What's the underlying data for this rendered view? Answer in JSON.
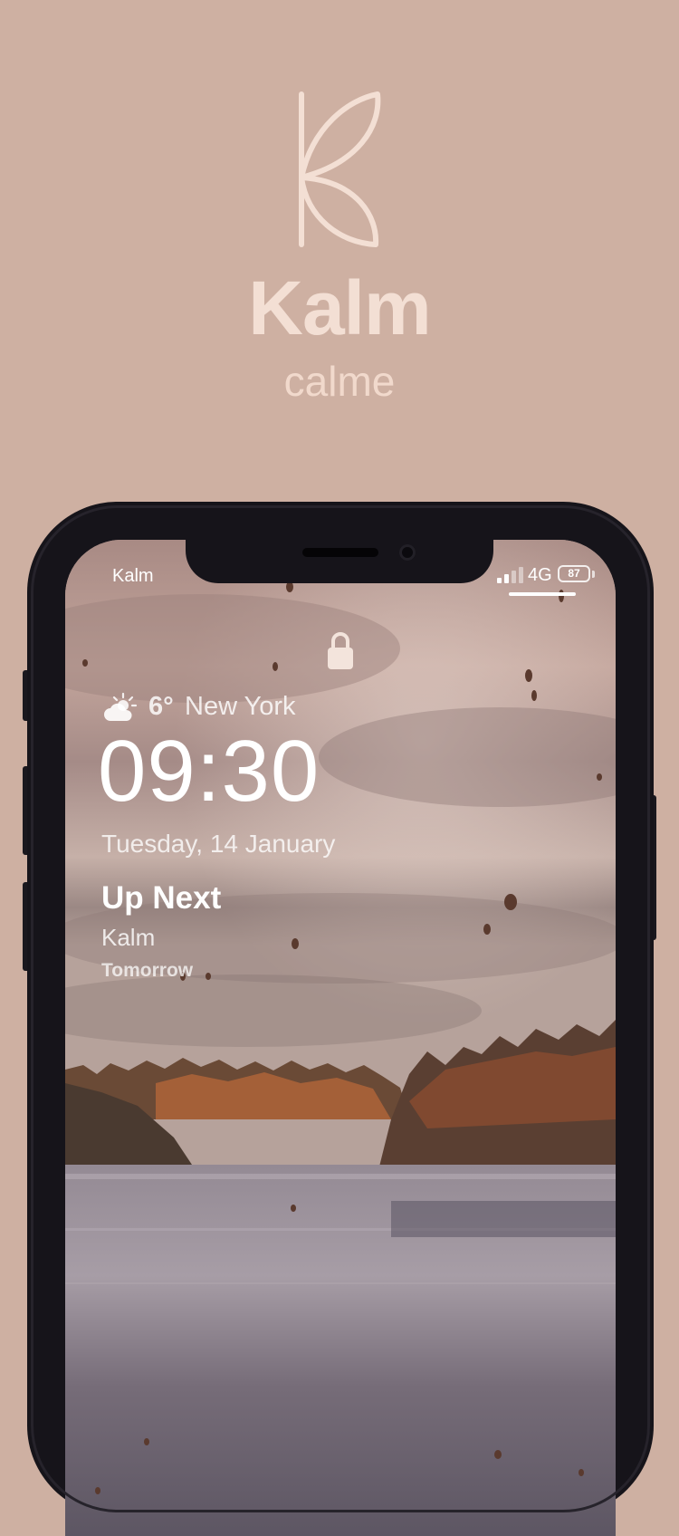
{
  "brand": {
    "title": "Kalm",
    "subtitle": "calme",
    "logo_icon": "leaf-logo-icon",
    "color": "#f3dfd4"
  },
  "status_bar": {
    "carrier": "Kalm",
    "network": "4G",
    "battery": "87"
  },
  "lock_screen": {
    "weather": {
      "icon": "partly-cloudy-icon",
      "temperature": "6°",
      "city": "New York"
    },
    "time": "09:30",
    "date": "Tuesday, 14 January",
    "up_next": {
      "title": "Up Next",
      "event": "Kalm",
      "when": "Tomorrow"
    }
  },
  "colors": {
    "background": "#ceb0a2",
    "phone_frame": "#16141a"
  }
}
